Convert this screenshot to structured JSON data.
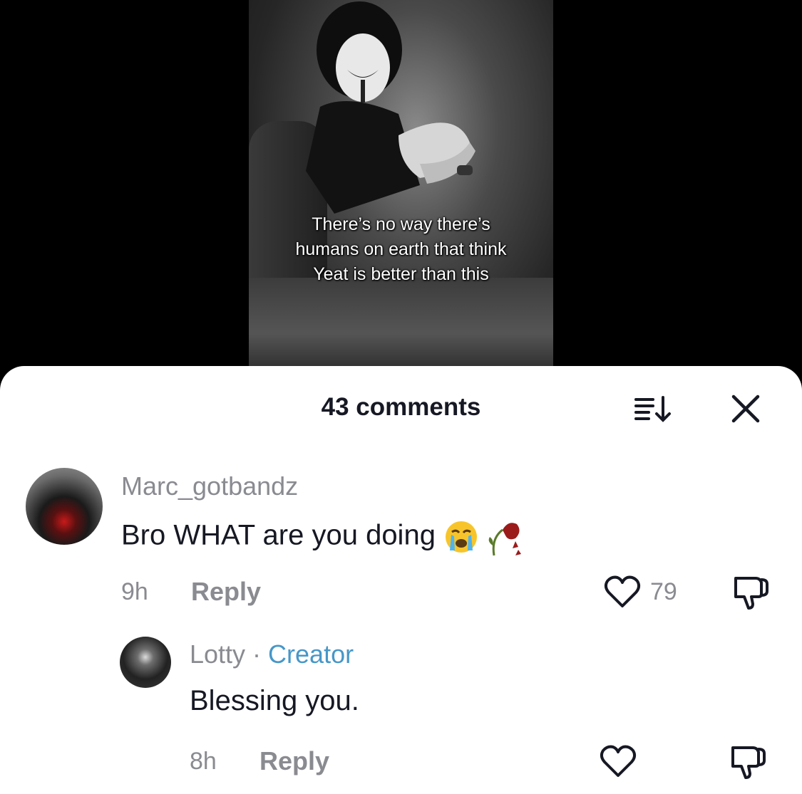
{
  "video": {
    "caption_line1": "There’s no way there’s",
    "caption_line2": "humans on earth that think",
    "caption_line3": "Yeat is better than this"
  },
  "sheet": {
    "title": "43 comments",
    "sort_icon": "sort-descending-icon",
    "close_icon": "close-icon"
  },
  "comments": [
    {
      "username": "Marc_gotbandz",
      "text": "Bro WHAT are you doing",
      "emojis": [
        "loudly-crying-face",
        "wilted-flower"
      ],
      "time": "9h",
      "reply_label": "Reply",
      "like_count": "79"
    },
    {
      "username": "Lotty",
      "separator": " · ",
      "badge": "Creator",
      "text": "Blessing you.",
      "time": "8h",
      "reply_label": "Reply"
    }
  ],
  "colors": {
    "text_primary": "#161823",
    "text_secondary": "#8a8b91",
    "creator_badge": "#4797c8",
    "sheet_bg": "#ffffff",
    "backdrop": "#000000"
  }
}
